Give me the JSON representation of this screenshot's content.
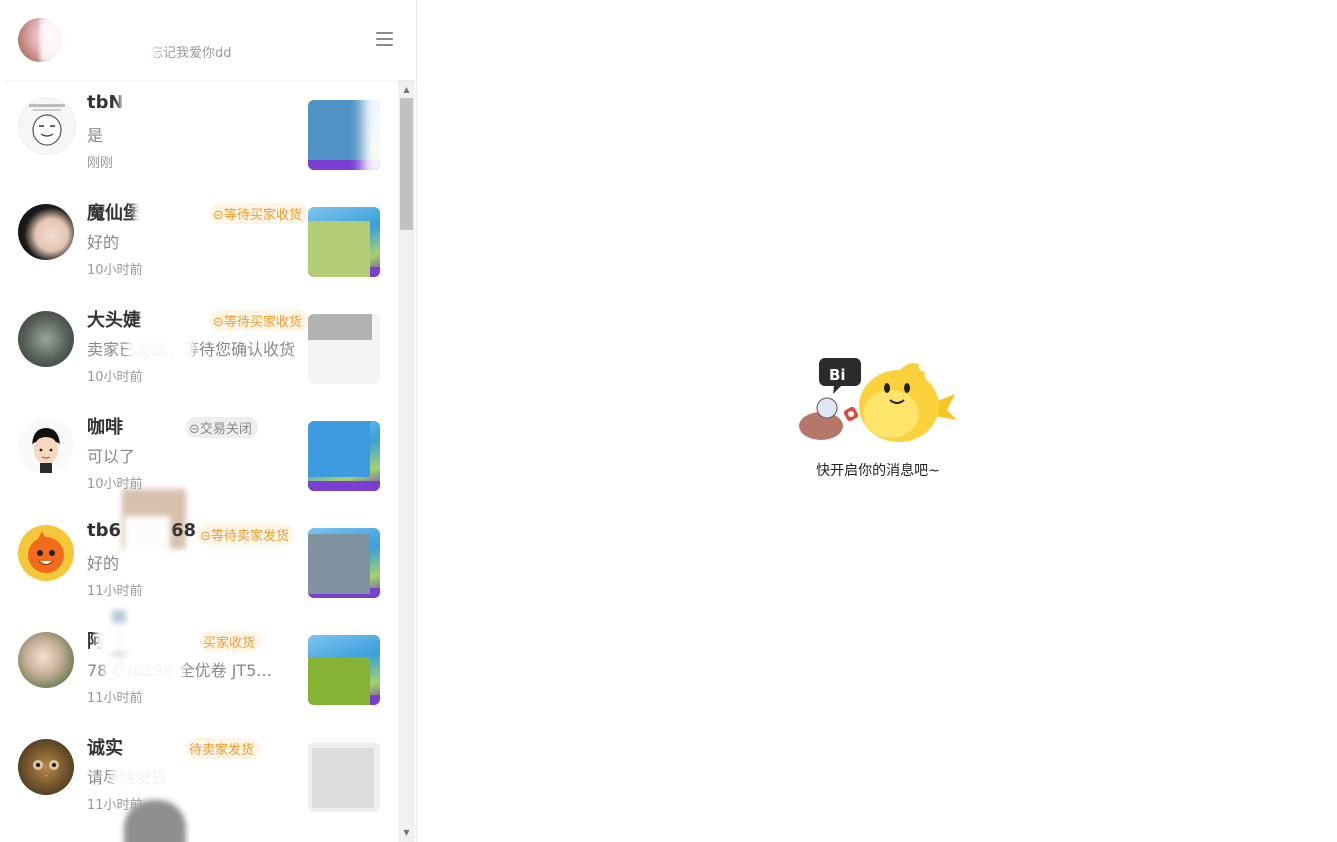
{
  "header": {
    "signature": "忘记我爱你dd"
  },
  "conversations": [
    {
      "name": "tbN",
      "status": "",
      "message": "是",
      "time": "刚刚",
      "avatar_color": "#f4f4f4",
      "cover_color": "#5192c4"
    },
    {
      "name": "魔仙堡",
      "status": "⊝等待买家收货",
      "message": "好的",
      "time": "10小时前",
      "avatar_color": "#e9d2c4",
      "cover_color": "#b3cd76"
    },
    {
      "name": "大头婕",
      "status": "⊝等待买家收货",
      "message": "卖家已发货，等待您确认收货",
      "time": "10小时前",
      "avatar_color": "#4f5a50",
      "cover_color": "#b2b2b2"
    },
    {
      "name": "咖啡",
      "status": "⊝交易关闭",
      "message": "可以了",
      "time": "10小时前",
      "avatar_color": "#fafafa",
      "cover_color": "#3d9be0"
    },
    {
      "name": "tb6",
      "name_suffix": "68",
      "status": "⊝等待卖家发货",
      "message": "好的",
      "time": "11小时前",
      "avatar_color": "#f5a623",
      "cover_color": "#7f929f"
    },
    {
      "name": "阿",
      "status": "买家收货",
      "message": "78 096196 全优卷 JT5...",
      "time": "11小时前",
      "avatar_color": "#c7b39e",
      "cover_color": "#86b333"
    },
    {
      "name": "诚实",
      "status": "待卖家发货",
      "message": "请尽快发货",
      "time": "11小时前",
      "avatar_color": "#7a5a2e",
      "cover_color": "#dcdcdc"
    }
  ],
  "main": {
    "empty_text": "快开启你的消息吧~",
    "mascot_icon": "bi-chat-fish-mascot"
  }
}
